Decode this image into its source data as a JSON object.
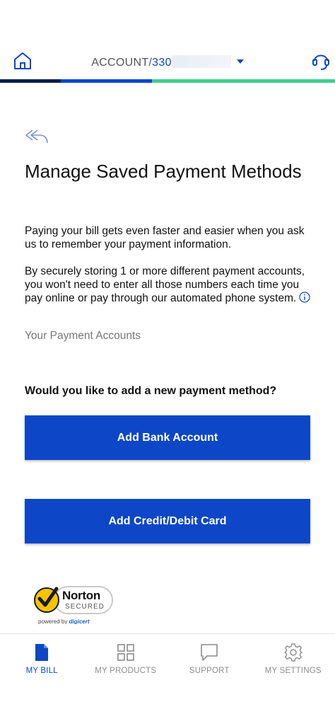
{
  "header": {
    "account_prefix": "ACCOUNT/",
    "account_number_visible": "330"
  },
  "page": {
    "title": "Manage Saved Payment Methods",
    "paragraph1": "Paying your bill gets even faster and easier when you ask us to remember your payment information.",
    "paragraph2": "By securely storing 1 or more different payment accounts, you won't need to enter all those numbers each time you pay online or pay through our automated phone system.",
    "section_label": "Your Payment Accounts",
    "question": "Would you like to add a new payment method?",
    "add_bank_label": "Add Bank Account",
    "add_card_label": "Add Credit/Debit Card"
  },
  "norton": {
    "name": "Norton",
    "secured": "SECURED",
    "powered_prefix": "powered by",
    "powered_brand": "digicert"
  },
  "nav": {
    "items": [
      {
        "label": "MY BILL",
        "icon": "document-icon",
        "active": true
      },
      {
        "label": "MY PRODUCTS",
        "icon": "grid-icon",
        "active": false
      },
      {
        "label": "SUPPORT",
        "icon": "chat-icon",
        "active": false
      },
      {
        "label": "MY SETTINGS",
        "icon": "gear-icon",
        "active": false
      }
    ]
  },
  "colors": {
    "primary": "#0d47c7",
    "progress_dark": "#0b1f4a",
    "progress_green": "#3ecf8e",
    "muted": "#8c8c8c"
  }
}
